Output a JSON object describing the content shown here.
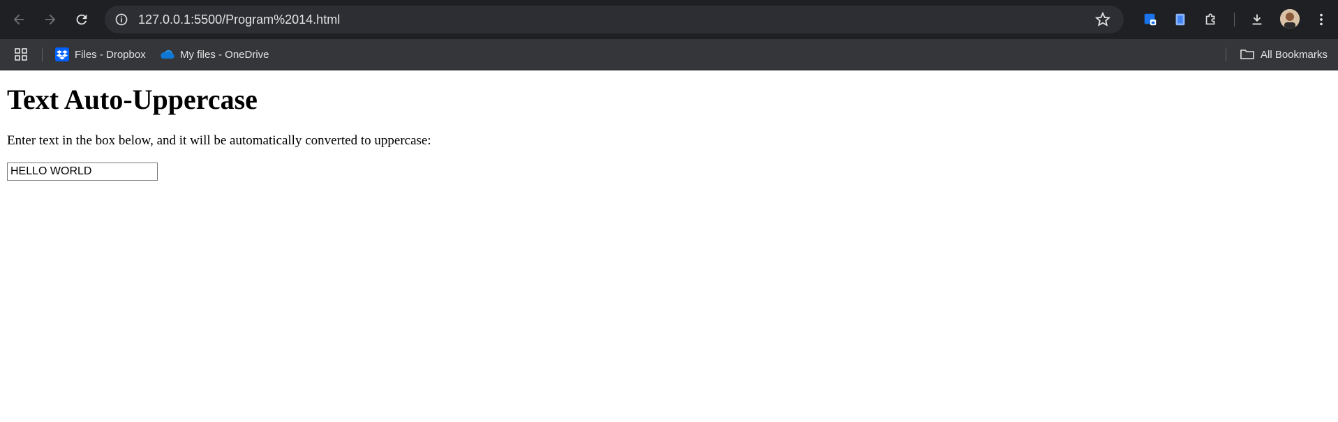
{
  "browser": {
    "url": "127.0.0.1:5500/Program%2014.html",
    "icons": {
      "back": "arrow-left-icon",
      "forward": "arrow-right-icon",
      "reload": "reload-icon",
      "info": "info-icon",
      "bookmark_star": "star-icon",
      "downloads": "download-icon",
      "menu": "kebab-menu-icon"
    }
  },
  "bookmarks": {
    "items": [
      {
        "label": "Files - Dropbox",
        "icon": "dropbox-icon"
      },
      {
        "label": "My files - OneDrive",
        "icon": "onedrive-icon"
      }
    ],
    "all_bookmarks_label": "All Bookmarks"
  },
  "page": {
    "title": "Text Auto-Uppercase",
    "description": "Enter text in the box below, and it will be automatically converted to uppercase:",
    "input_value": "HELLO WORLD"
  }
}
